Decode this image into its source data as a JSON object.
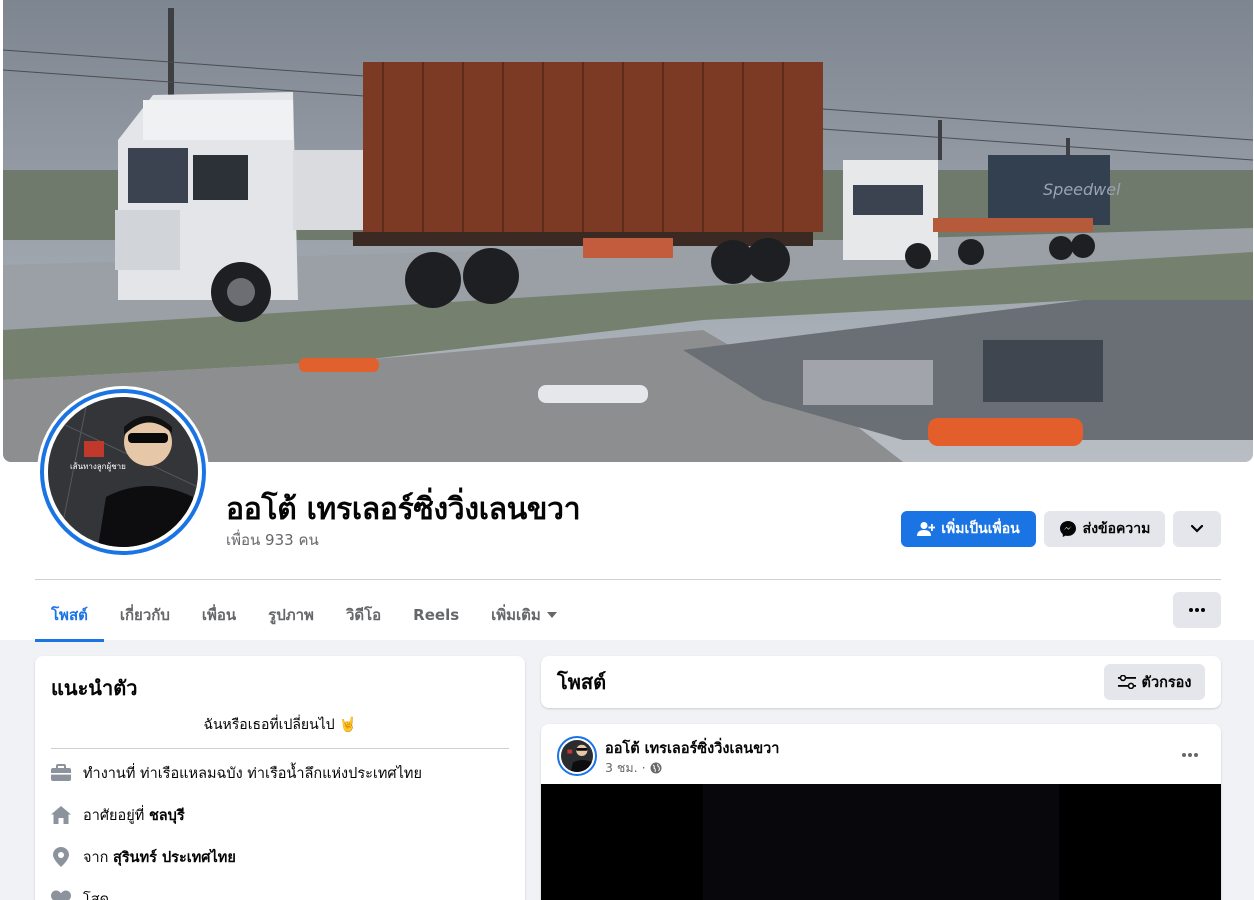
{
  "profile": {
    "name": "ออโต้ เทรเลอร์ซิ่งวิ่งเลนขวา",
    "friends": "เพื่อน 933 คน"
  },
  "actions": {
    "add_friend": "เพิ่มเป็นเพื่อน",
    "message": "ส่งข้อความ"
  },
  "tabs": [
    {
      "label": "โพสต์"
    },
    {
      "label": "เกี่ยวกับ"
    },
    {
      "label": "เพื่อน"
    },
    {
      "label": "รูปภาพ"
    },
    {
      "label": "วิดีโอ"
    },
    {
      "label": "Reels"
    },
    {
      "label": "เพิ่มเติม"
    }
  ],
  "intro": {
    "title": "แนะนำตัว",
    "bio": "ฉันหรือเธอที่เปลี่ยนไป 🤘",
    "work_prefix": "ทำงานที่",
    "work": "ท่าเรือแหลมฉบัง ท่าเรือน้ำลึกแห่งประเทศไทย",
    "lives_prefix": "อาศัยอยู่ที่",
    "lives": "ชลบุรี",
    "from_prefix": "จาก",
    "from": "สุรินทร์ ประเทศไทย",
    "status": "โสด"
  },
  "posts": {
    "title": "โพสต์",
    "filter": "ตัวกรอง",
    "items": [
      {
        "author": "ออโต้ เทรเลอร์ซิ่งวิ่งเลนขวา",
        "time": "3 ชม. ·"
      }
    ]
  },
  "cover_container_text": "Speedwel",
  "avatar_overlay_text": "เส้นทางลูกผู้ชาย",
  "colors": {
    "accent": "#1b74e4",
    "background": "#f0f2f5",
    "button_gray": "#e4e6eb",
    "secondary_text": "#65676b"
  }
}
